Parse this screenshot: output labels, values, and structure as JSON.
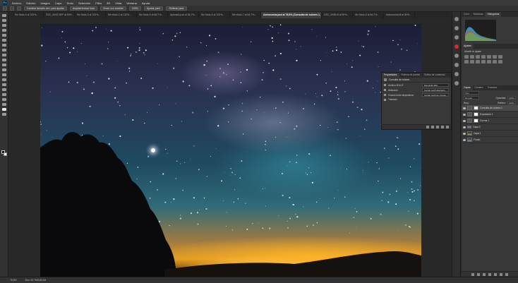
{
  "menubar": {
    "logo": "Ps",
    "items": [
      "Archivo",
      "Edición",
      "Imagen",
      "Capa",
      "Texto",
      "Selección",
      "Filtro",
      "3D",
      "Vista",
      "Ventana",
      "Ayuda"
    ]
  },
  "options": {
    "resize_windows": "Cambiar tamaño ven. para ajustar",
    "zoom_all": "Ampliar/reducir todo",
    "zoom_percent": "100%",
    "fit_screen": "Ajustar pant.",
    "fill_screen": "Rellenar pant.",
    "scrubby": "Zoom con arrastre"
  },
  "document_tabs": [
    {
      "label": "Sin título-4 al 100%..."
    },
    {
      "label": "DSC_0042.NEF al 50%..."
    },
    {
      "label": "Sin título-3 al 100%..."
    },
    {
      "label": "Sin título-2 al 112%..."
    },
    {
      "label": "Sin título-5 al 66,7%..."
    },
    {
      "label": "Aplicado.psd al 66,7%..."
    },
    {
      "label": "Sin título-6 al 100%..."
    },
    {
      "label": "Sin título-7 al 66,7%..."
    },
    {
      "label": "Astronomia.psd al 76,5% (Consulta de colores 1, RGB/16)",
      "active": true
    },
    {
      "label": "DSC_0058.tif al 50%..."
    },
    {
      "label": "Sin título-8 al 66,7%..."
    },
    {
      "label": "Astronomia.tif al 50%..."
    }
  ],
  "properties": {
    "tabs": [
      "Propiedades",
      "Rellena de parrilla",
      "Estilos de contenido"
    ],
    "title": "Consulta de colores",
    "rows": [
      {
        "label": "Archivo 3DLUT",
        "value": "Moonlight.3DL"
      },
      {
        "label": "Abstracto",
        "value": "Cargar perfil abstracto..."
      },
      {
        "label": "Vínculo entre dispositivos",
        "value": "Cargar perfil de vínculo..."
      },
      {
        "label": "Tramado",
        "value": ""
      }
    ]
  },
  "right_panel": {
    "top_tabs": [
      "Color",
      "Muestras",
      "Histograma"
    ],
    "adjust_tabs": [
      "Ajustes"
    ],
    "adjust_title": "Añadir un ajuste",
    "layers_tabs": [
      "Capas",
      "Canales",
      "Trazados"
    ],
    "kind": "Tipo",
    "blend": "Normal",
    "opacity_label": "Opacidad:",
    "opacity": "100%",
    "lock_label": "Bloq.:",
    "fill_label": "Relleno:",
    "fill": "100%",
    "layers": [
      {
        "name": "Consulta de colores 1",
        "thumb": "adj",
        "selected": true
      },
      {
        "name": "Exposición 1",
        "thumb": "adj"
      },
      {
        "name": "Curvas 1",
        "thumb": "adj"
      },
      {
        "name": "Capa 2",
        "thumb": "img"
      },
      {
        "name": "Capa 1",
        "thumb": "img"
      },
      {
        "name": "Fondo",
        "thumb": "img"
      }
    ]
  },
  "status": {
    "zoom": "76,5%",
    "doc": "Doc: 52,7M/105,2M"
  },
  "colors": {
    "accent": "#31a8ff",
    "ui_dark": "#282828",
    "panel": "#383838"
  }
}
